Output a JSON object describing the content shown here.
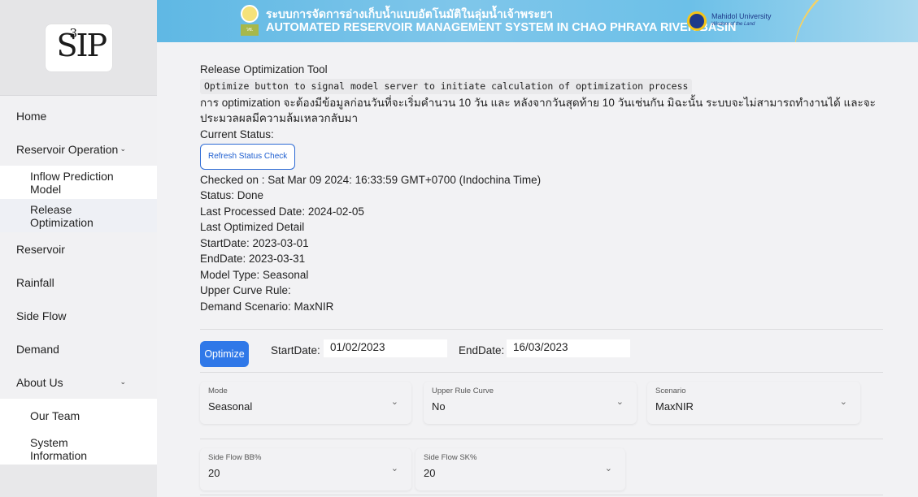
{
  "sidebar": {
    "logo": {
      "main": "SIP",
      "sup": "3"
    },
    "items": [
      {
        "label": "Home"
      },
      {
        "label": "Reservoir Operation",
        "chevron": "⌄"
      },
      {
        "label": "Inflow Prediction Model"
      },
      {
        "label": "Release Optimization"
      },
      {
        "label": "Reservoir"
      },
      {
        "label": "Rainfall"
      },
      {
        "label": "Side Flow"
      },
      {
        "label": "Demand"
      },
      {
        "label": "About Us",
        "chevron": "⌄"
      },
      {
        "label": "Our Team"
      },
      {
        "label": "System Information"
      }
    ]
  },
  "banner": {
    "title_th": "ระบบการจัดการอ่างเก็บน้ำแบบอัตโนมัติในลุ่มน้ำเจ้าพระยา",
    "title_en": "AUTOMATED RESERVOIR MANAGEMENT SYSTEM IN CHAO PHRAYA RIVER BASIN",
    "emblem_text": "วช.",
    "partner_name": "Mahidol University",
    "partner_sub": "Wisdom of the Land"
  },
  "tool": {
    "title": "Release Optimization Tool",
    "code_note": "Optimize button to signal model server to initiate calculation of optimization process",
    "thai_note": "การ optimization จะต้องมีข้อมูลก่อนวันที่จะเริ่มคำนวน 10 วัน และ หลังจากวันสุดท้าย 10 วันเช่นกัน มิฉะนั้น ระบบจะไม่สามารถทำงานได้ และจะประมวลผลมีความล้มเหลวกลับมา",
    "current_status_label": "Current Status:",
    "refresh_label": "Refresh Status Check",
    "checked_on": "Checked on : Sat Mar 09 2024: 16:33:59 GMT+0700 (Indochina Time)",
    "status": "Status: Done",
    "last_processed": "Last Processed Date: 2024-02-05",
    "last_optimized": "Last Optimized Detail",
    "start_date": "StartDate: 2023-03-01",
    "end_date": "EndDate: 2023-03-31",
    "model_type": "Model Type: Seasonal",
    "upper_curve": "Upper Curve Rule:",
    "demand_scenario": "Demand Scenario: MaxNIR"
  },
  "controls": {
    "optimize_label": "Optimize",
    "start_label": "StartDate:",
    "start_value": "01/02/2023",
    "end_label": "EndDate:",
    "end_value": "16/03/2023",
    "selects": [
      {
        "label": "Mode",
        "value": "Seasonal"
      },
      {
        "label": "Upper Rule Curve",
        "value": "No"
      },
      {
        "label": "Scenario",
        "value": "MaxNIR"
      },
      {
        "label": "Side Flow BB%",
        "value": "20"
      },
      {
        "label": "Side Flow SK%",
        "value": "20"
      }
    ],
    "chevron": "⌄"
  }
}
